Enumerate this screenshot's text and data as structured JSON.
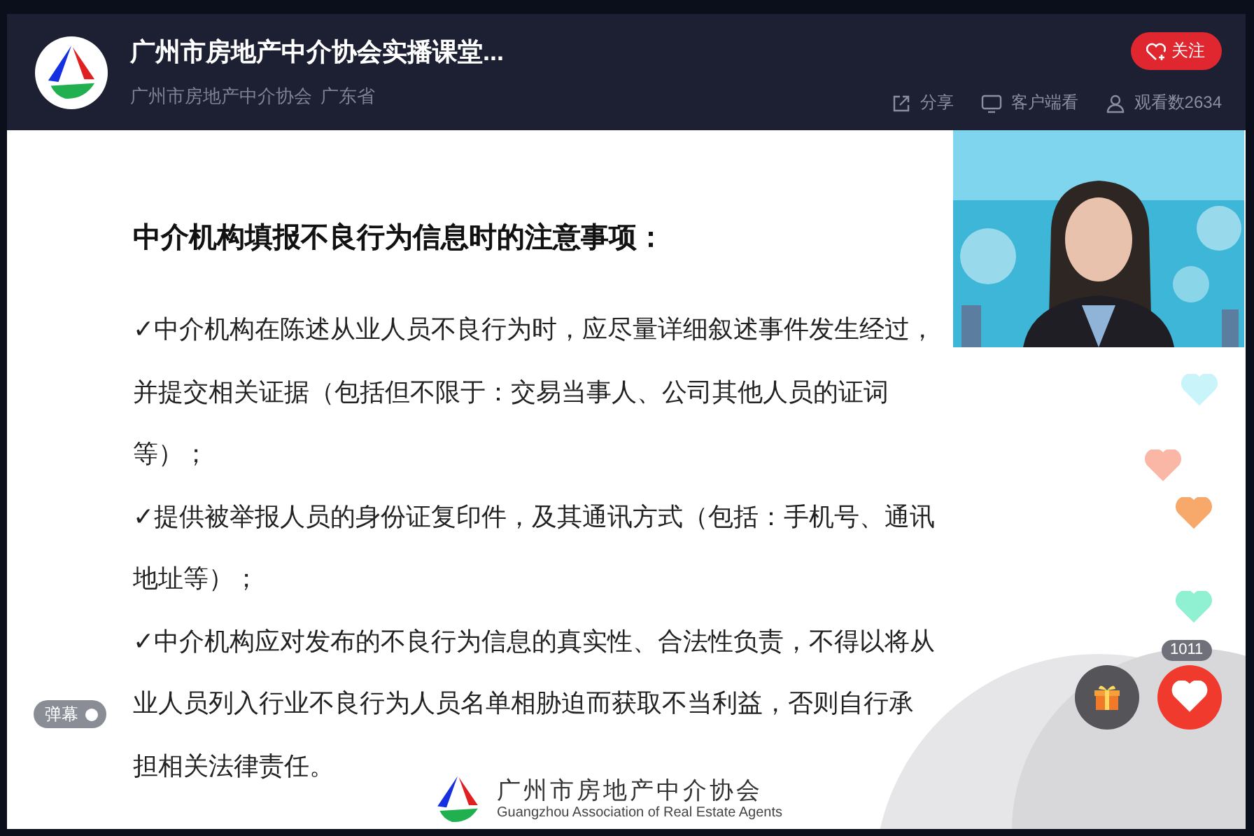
{
  "header": {
    "title": "广州市房地产中介协会实播课堂...",
    "organizer": "广州市房地产中介协会",
    "region": "广东省",
    "follow_button": "关注",
    "stats": [
      {
        "kind": "share",
        "label": "分享"
      },
      {
        "kind": "client",
        "label": "客户端看"
      },
      {
        "kind": "viewers",
        "label": "观看数2634"
      }
    ]
  },
  "slide": {
    "heading": "中介机构填报不良行为信息时的注意事项：",
    "lines": [
      "✓中介机构在陈述从业人员不良行为时，应尽量详细叙述事件发生经过，",
      "并提交相关证据（包括但不限于：交易当事人、公司其他人员的证词",
      "等）；",
      "✓提供被举报人员的身份证复印件，及其通讯方式（包括：手机号、通讯",
      "地址等）；",
      "✓中介机构应对发布的不良行为信息的真实性、合法性负责，不得以将从",
      "业人员列入行业不良行为人员名单相胁迫而获取不当利益，否则自行承",
      "担相关法律责任。"
    ],
    "footer_name": "广州市房地产中介协会",
    "footer_subtitle": "Guangzhou Association of Real Estate Agents"
  },
  "floating_hearts": [
    {
      "color": "#c8f4fa"
    },
    {
      "color": "#fbb7a6"
    },
    {
      "color": "#f6a96b"
    },
    {
      "color": "#8ff0d2"
    }
  ],
  "danmaku_toggle": {
    "label": "弹幕",
    "on": true
  },
  "like_count": "1011"
}
